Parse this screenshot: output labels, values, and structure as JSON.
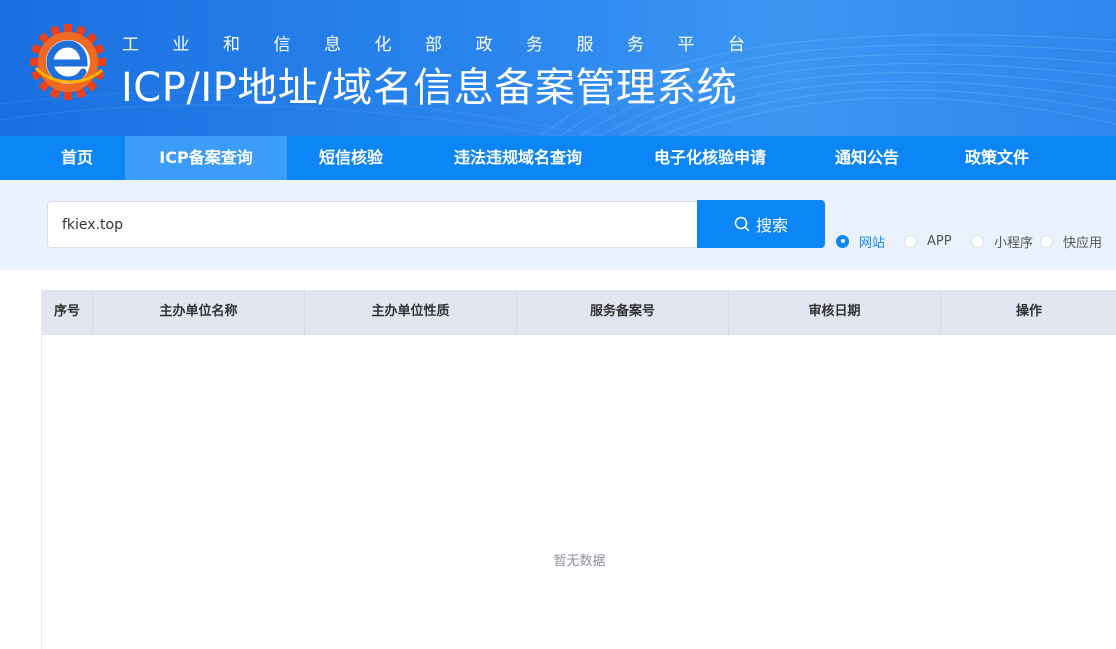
{
  "header": {
    "subtitle": "工业和信息化部政务服务平台",
    "title": "ICP/IP地址/域名信息备案管理系统",
    "logo_icon": "gear-e-logo-icon",
    "colors": {
      "banner": "#1a6fe0",
      "nav": "#0c86f6",
      "nav_active": "#3b9df7"
    }
  },
  "nav": {
    "items": [
      {
        "label": "首页"
      },
      {
        "label": "ICP备案查询"
      },
      {
        "label": "短信核验"
      },
      {
        "label": "违法违规域名查询"
      },
      {
        "label": "电子化核验申请"
      },
      {
        "label": "通知公告"
      },
      {
        "label": "政策文件"
      }
    ],
    "active": "ICP备案查询"
  },
  "search": {
    "value": "fkiex.top",
    "button_label": "搜索",
    "button_icon": "search-icon",
    "types": [
      {
        "label": "网站",
        "checked": true
      },
      {
        "label": "APP",
        "checked": false
      },
      {
        "label": "小程序",
        "checked": false
      },
      {
        "label": "快应用",
        "checked": false
      }
    ]
  },
  "table": {
    "columns": [
      "序号",
      "主办单位名称",
      "主办单位性质",
      "服务备案号",
      "审核日期",
      "操作"
    ],
    "rows": [],
    "empty_text": "暂无数据"
  }
}
